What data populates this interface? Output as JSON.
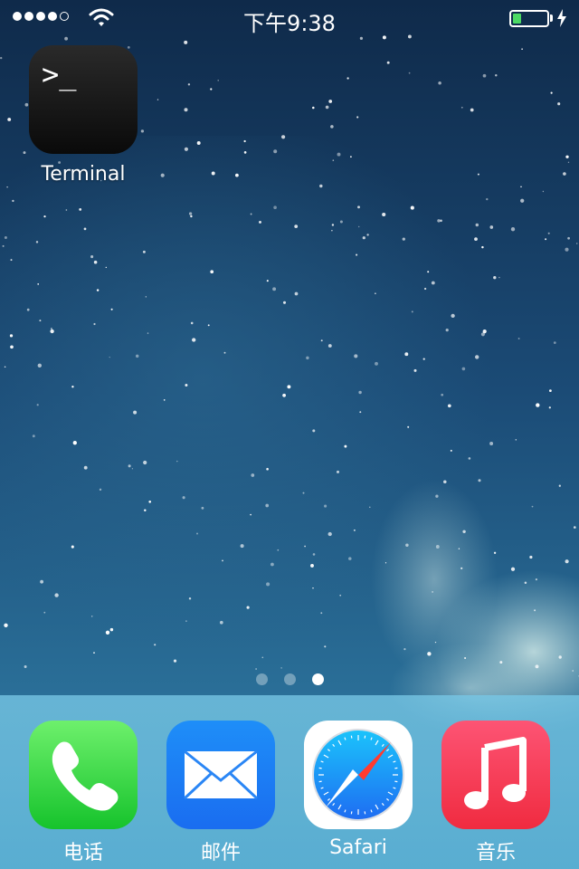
{
  "status_bar": {
    "signal_bars_filled": 4,
    "signal_bars_total": 5,
    "time": "下午9:38",
    "battery_level": 0.25,
    "charging": true,
    "battery_color": "#4cd964"
  },
  "home": {
    "apps": [
      {
        "label": "Terminal",
        "icon": "terminal-icon",
        "prompt": ">_"
      }
    ],
    "page_count": 3,
    "current_page": 3
  },
  "dock": {
    "apps": [
      {
        "label": "电话",
        "icon": "phone-icon",
        "color": "#4cd964"
      },
      {
        "label": "邮件",
        "icon": "mail-icon",
        "color": "#1a82f6"
      },
      {
        "label": "Safari",
        "icon": "safari-compass-icon",
        "color": "#1e90ff"
      },
      {
        "label": "音乐",
        "icon": "music-note-icon",
        "color": "#fc3c5a"
      }
    ]
  }
}
